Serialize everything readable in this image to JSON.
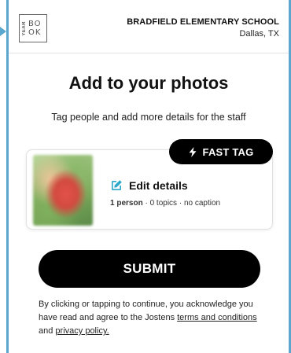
{
  "header": {
    "logo_top": "YEAR",
    "logo_book_lines": [
      "BO",
      "OK"
    ],
    "school_name": "BRADFIELD ELEMENTARY SCHOOL",
    "school_location": "Dallas, TX"
  },
  "page": {
    "title": "Add to your photos",
    "subtitle": "Tag people and add more details for the staff"
  },
  "fast_tag": {
    "label": "FAST TAG"
  },
  "photo_card": {
    "edit_label": "Edit details",
    "person_count": "1 person",
    "separator": "·",
    "topics": "0 topics",
    "caption": "no caption"
  },
  "submit": {
    "label": "SUBMIT"
  },
  "legal": {
    "text_before": "By clicking or tapping to continue, you acknowledge you have read and agree to the Jostens ",
    "terms_link": "terms and conditions",
    "text_middle": " and ",
    "privacy_link": "privacy policy.",
    "text_after": ""
  },
  "colors": {
    "accent_border": "#5aa6cf",
    "edit_icon": "#2aa7c9",
    "button_bg": "#000000"
  },
  "icons": {
    "edit": "edit-pencil-icon",
    "bolt": "lightning-bolt-icon"
  }
}
